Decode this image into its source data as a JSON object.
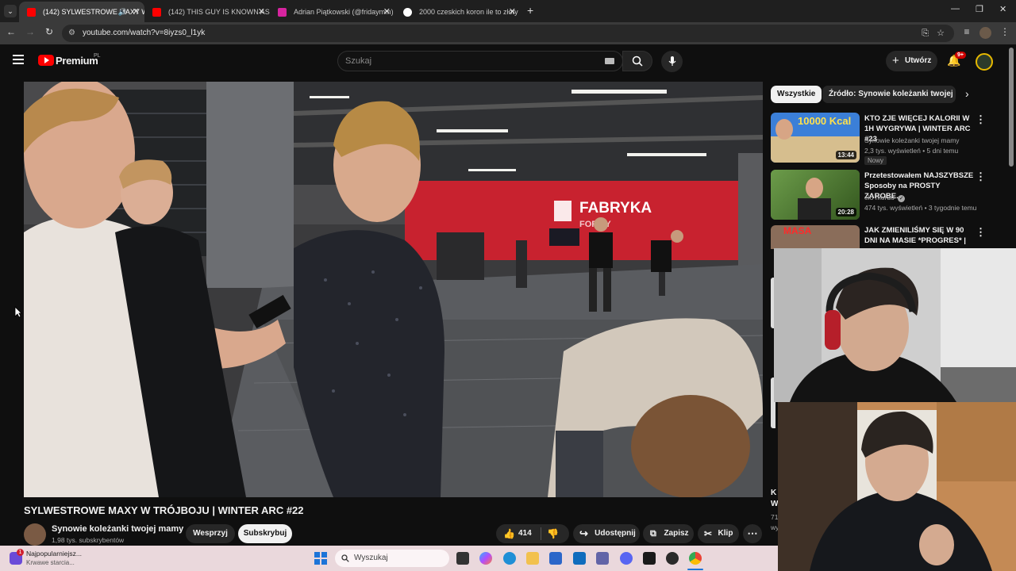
{
  "browser": {
    "tabs": [
      {
        "title": "(142) SYLWESTROWE MAXY W TRÓJBOJU",
        "active": true,
        "favicon_color": "#ff0000"
      },
      {
        "title": "(142) THIS GUY IS KNOWN AS THE",
        "active": false,
        "favicon_color": "#ff0000"
      },
      {
        "title": "Adrian Piątkowski (@fridaymm)",
        "active": false,
        "favicon_color": "#d6249f"
      },
      {
        "title": "2000 czeskich koron ile to złoty",
        "active": false,
        "favicon_color": "#4285f4"
      }
    ],
    "url": "youtube.com/watch?v=8iyzs0_l1yk"
  },
  "youtube": {
    "logo_text": "Premium",
    "logo_region": "PL",
    "search_placeholder": "Szukaj",
    "create_label": "Utwórz",
    "notifications_badge": "9+"
  },
  "video": {
    "title": "SYLWESTROWE MAXY W TRÓJBOJU | WINTER ARC #22",
    "gym_sign": "FABRYKA",
    "gym_sign2": "FORMY"
  },
  "channel": {
    "name": "Synowie koleżanki twojej mamy",
    "subscribers": "1,98 tys. subskrybentów",
    "support_label": "Wesprzyj",
    "subscribe_label": "Subskrybuj"
  },
  "actions": {
    "likes": "414",
    "share_label": "Udostępnij",
    "save_label": "Zapisz",
    "clip_label": "Klip"
  },
  "chips": [
    "Wszystkie",
    "Źródło: Synowie koleżanki twojej mamy"
  ],
  "recommendations": [
    {
      "title": "KTO ZJE WIĘCEJ KALORII W 1H WYGRYWA | WINTER ARC #23",
      "channel": "Synowie koleżanki twojej mamy",
      "meta": "2,3 tys. wyświetleń • 5 dni temu",
      "badge": "Nowy",
      "duration": "13:44",
      "thumb_text": "10000 Kcal",
      "verified": false
    },
    {
      "title": "Przetestowałem NAJSZYBSZE Sposoby na PROSTY ZAROBE...",
      "channel": "elo mordo",
      "meta": "474 tys. wyświetleń • 3 tygodnie temu",
      "badge": "",
      "duration": "20:28",
      "thumb_text": "",
      "verified": true
    },
    {
      "title": "JAK ZMIENILIŚMY SIĘ W 90 DNI NA MASIE *PROGRES* | ...",
      "channel": "",
      "meta": "",
      "badge": "",
      "duration": "",
      "thumb_text": "MASA",
      "verified": false
    }
  ],
  "sidebar_partial": {
    "line1": "K",
    "line2": "W",
    "line3": "71",
    "line4": "wy"
  },
  "taskbar": {
    "widget_title": "Najpopularniejsz...",
    "widget_subtitle": "Krwawe starcia...",
    "widget_badge": "1",
    "search_placeholder": "Wyszukaj"
  },
  "colors": {
    "youtube_red": "#ff0000",
    "background": "#0f0f0f",
    "subscribe_bg": "#f1f1f1",
    "gym_wall": "#c8222f"
  }
}
